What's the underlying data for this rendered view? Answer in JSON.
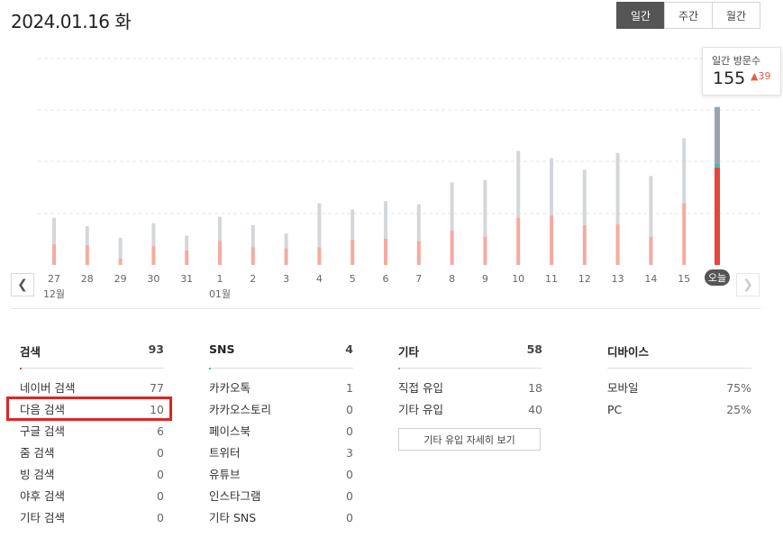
{
  "header": {
    "date": "2024.01.16 화"
  },
  "period_tabs": [
    {
      "label": "일간",
      "active": true
    },
    {
      "label": "주간",
      "active": false
    },
    {
      "label": "월간",
      "active": false
    }
  ],
  "tooltip": {
    "title": "일간 방문수",
    "value": "155",
    "change": "39",
    "change_direction": "up"
  },
  "nav": {
    "prev_icon": "chevron-left-icon",
    "next_icon": "chevron-right-icon"
  },
  "colors": {
    "search": "#f4aba0",
    "other": "#d4d7da",
    "today_search": "#e8453c",
    "today_other": "#9aa3ad",
    "sns_accent": "#3bbfb0",
    "highlight": "#e02424"
  },
  "chart_data": {
    "type": "bar",
    "stacked": true,
    "grid": true,
    "categories": [
      "27",
      "28",
      "29",
      "30",
      "31",
      "1",
      "2",
      "3",
      "4",
      "5",
      "6",
      "7",
      "8",
      "9",
      "10",
      "11",
      "12",
      "13",
      "14",
      "15",
      "오늘"
    ],
    "month_labels": [
      {
        "at": "27",
        "label": "12월"
      },
      {
        "at": "1",
        "label": "01월"
      }
    ],
    "series": [
      {
        "values": [
          20,
          19,
          6,
          18,
          14,
          23,
          17,
          16,
          17,
          24,
          25,
          23,
          33,
          27,
          45,
          47,
          38,
          39,
          27,
          59,
          93
        ]
      },
      {
        "values": [
          25,
          18,
          20,
          22,
          14,
          23,
          21,
          14,
          42,
          29,
          36,
          35,
          46,
          54,
          64,
          55,
          53,
          68,
          58,
          62,
          58
        ]
      }
    ],
    "ylim": [
      0,
      155
    ]
  },
  "panels": {
    "search": {
      "title": "검색",
      "count": "93",
      "rows": [
        {
          "label": "네이버 검색",
          "value": "77"
        },
        {
          "label": "다음 검색",
          "value": "10"
        },
        {
          "label": "구글 검색",
          "value": "6"
        },
        {
          "label": "줌 검색",
          "value": "0"
        },
        {
          "label": "빙 검색",
          "value": "0"
        },
        {
          "label": "야후 검색",
          "value": "0"
        },
        {
          "label": "기타 검색",
          "value": "0"
        }
      ]
    },
    "sns": {
      "title": "SNS",
      "count": "4",
      "rows": [
        {
          "label": "카카오톡",
          "value": "1"
        },
        {
          "label": "카카오스토리",
          "value": "0"
        },
        {
          "label": "페이스북",
          "value": "0"
        },
        {
          "label": "트위터",
          "value": "3"
        },
        {
          "label": "유튜브",
          "value": "0"
        },
        {
          "label": "인스타그램",
          "value": "0"
        },
        {
          "label": "기타 SNS",
          "value": "0"
        }
      ]
    },
    "other": {
      "title": "기타",
      "count": "58",
      "rows": [
        {
          "label": "직접 유입",
          "value": "18"
        },
        {
          "label": "기타 유입",
          "value": "40"
        }
      ],
      "detail_button": "기타 유입 자세히 보기"
    },
    "device": {
      "title": "디바이스",
      "rows": [
        {
          "label": "모바일",
          "value": "75%"
        },
        {
          "label": "PC",
          "value": "25%"
        }
      ]
    }
  }
}
